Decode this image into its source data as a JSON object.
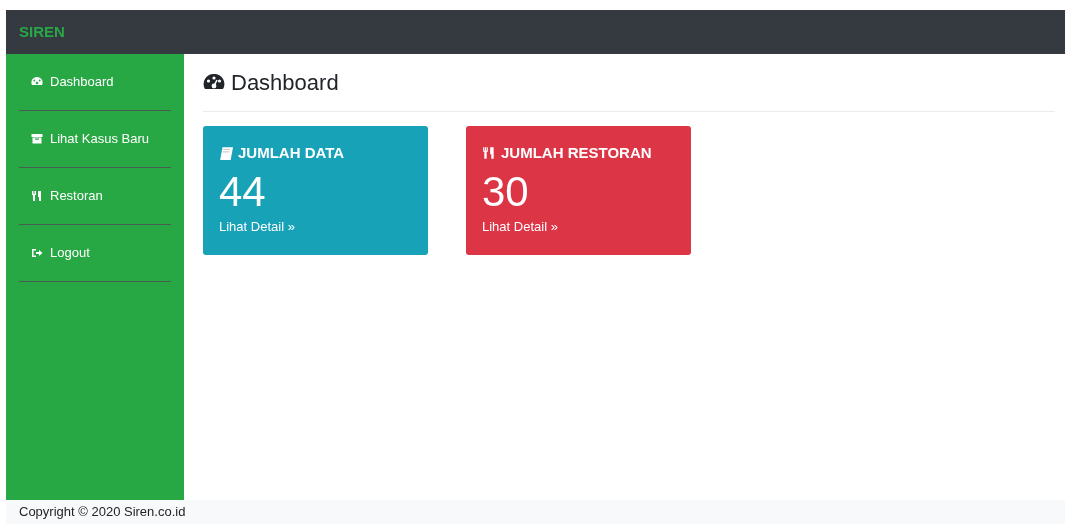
{
  "brand": "SIREN",
  "sidebar": {
    "items": [
      {
        "label": "Dashboard"
      },
      {
        "label": "Lihat Kasus Baru"
      },
      {
        "label": "Restoran"
      },
      {
        "label": "Logout"
      }
    ]
  },
  "page_title": "Dashboard",
  "cards": [
    {
      "title": "JUMLAH DATA",
      "value": "44",
      "link": "Lihat Detail »",
      "color": "#17a2b8"
    },
    {
      "title": "JUMLAH RESTORAN",
      "value": "30",
      "link": "Lihat Detail »",
      "color": "#dc3545"
    }
  ],
  "footer": "Copyright © 2020 Siren.co.id"
}
